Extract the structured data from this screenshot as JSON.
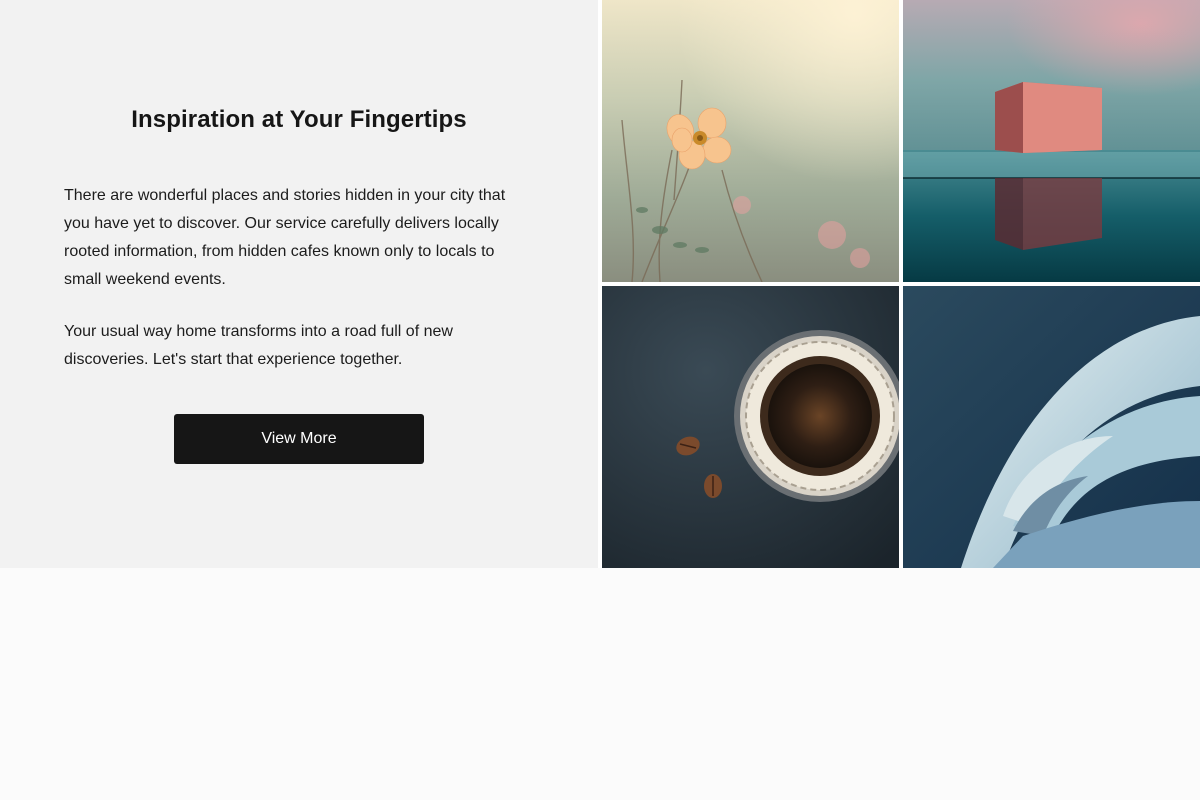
{
  "hero": {
    "headline": "Inspiration at Your Fingertips",
    "paragraphs": [
      "There are wonderful places and stories hidden in your city that you have yet to discover. Our service carefully delivers locally rooted information, from hidden cafes known only to locals to small weekend events.",
      "Your usual way home transforms into a road full of new discoveries. Let's start that experience together."
    ],
    "cta_label": "View More"
  },
  "gallery": {
    "tiles": [
      {
        "subject": "flower-photo",
        "accent": "#f6c78f"
      },
      {
        "subject": "cube-reflection-photo",
        "accent": "#d97a70"
      },
      {
        "subject": "coffee-filter-photo",
        "accent": "#2c3a44"
      },
      {
        "subject": "arches-photo",
        "accent": "#9fc3d4"
      }
    ]
  },
  "colors": {
    "panel_bg": "#f2f2f2",
    "button_bg": "#161616",
    "page_bg": "#fbfbfb"
  }
}
